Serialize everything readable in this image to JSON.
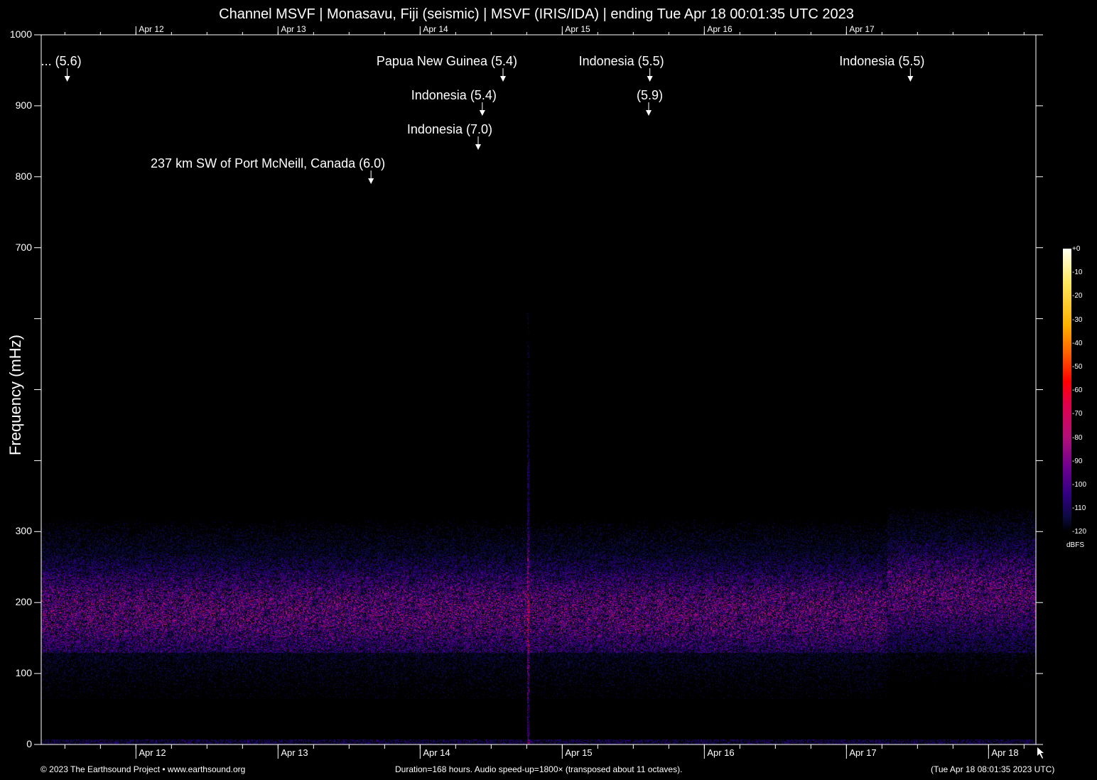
{
  "chart_data": {
    "type": "heatmap",
    "title": "Channel MSVF | Monasavu, Fiji (seismic) | MSVF (IRIS/IDA) | ending Tue Apr 18 00:01:35 UTC 2023",
    "ylabel": "Frequency (mHz)",
    "ylim": [
      0,
      1000
    ],
    "yticks": [
      0,
      100,
      200,
      300,
      400,
      500,
      600,
      700,
      800,
      900,
      1000
    ],
    "ytick_labels": [
      "0",
      "100",
      "200",
      "300",
      "",
      "",
      "",
      "700",
      "800",
      "900",
      "1000"
    ],
    "duration_hours": 168,
    "xticks": [
      {
        "label": "Apr 12",
        "hours": 16
      },
      {
        "label": "Apr 13",
        "hours": 40
      },
      {
        "label": "Apr 14",
        "hours": 64
      },
      {
        "label": "Apr 15",
        "hours": 88
      },
      {
        "label": "Apr 16",
        "hours": 112
      },
      {
        "label": "Apr 17",
        "hours": 136
      },
      {
        "label": "Apr 18",
        "hours": 160
      }
    ],
    "top_xticks": [
      "Apr 12",
      "Apr 13",
      "Apr 14",
      "Apr 15",
      "Apr 16",
      "Apr 17"
    ],
    "events": [
      {
        "label": "... (5.6)",
        "hours": 4.4,
        "row": 0
      },
      {
        "label": "Papua New Guinea (5.4)",
        "hours": 78.0,
        "row": 0
      },
      {
        "label": "Indonesia (5.5)",
        "hours": 102.8,
        "row": 0
      },
      {
        "label": "Indonesia (5.5)",
        "hours": 146.8,
        "row": 0
      },
      {
        "label": "Indonesia (5.4)",
        "hours": 74.5,
        "row": 1
      },
      {
        "label": "(5.9)",
        "hours": 102.6,
        "row": 1
      },
      {
        "label": "Indonesia (7.0)",
        "hours": 73.8,
        "row": 2
      },
      {
        "label": "237 km SW of Port McNeill, Canada (6.0)",
        "hours": 55.7,
        "row": 3
      }
    ],
    "colorbar": {
      "unit": "dBFS",
      "range": [
        -120,
        0
      ],
      "labels": [
        "+0",
        "-10",
        "-20",
        "-30",
        "-40",
        "-50",
        "-60",
        "-70",
        "-80",
        "-90",
        "-100",
        "-110",
        "-120"
      ]
    }
  },
  "footer": {
    "copyright": "© 2023 The Earthsound Project • www.earthsound.org",
    "info": "Duration=168 hours. Audio speed-up=1800× (transposed about 11 octaves).",
    "local_time": "(Tue Apr 18 08:01:35 2023 UTC)"
  }
}
